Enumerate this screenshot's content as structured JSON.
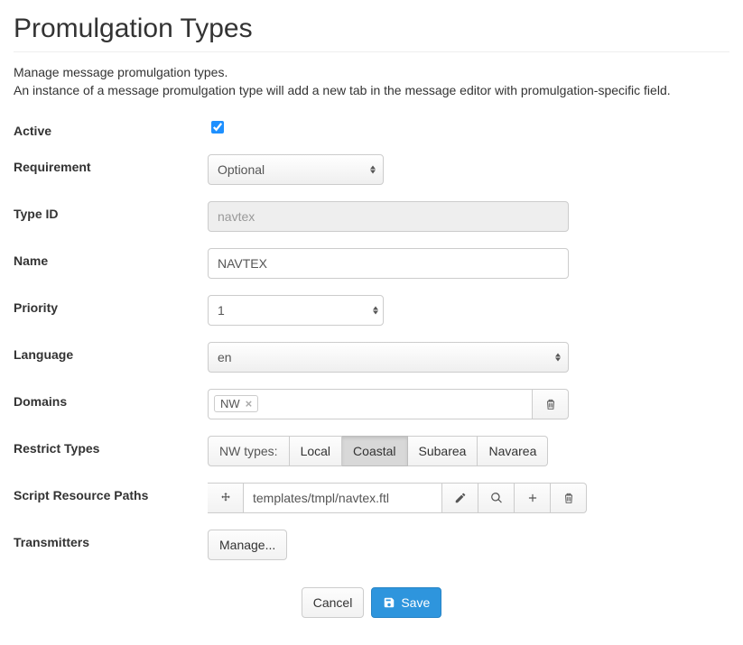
{
  "header": {
    "title": "Promulgation Types"
  },
  "description": {
    "line1": "Manage message promulgation types.",
    "line2": "An instance of a message promulgation type will add a new tab in the message editor with promulgation-specific field."
  },
  "form": {
    "active": {
      "label": "Active",
      "checked": true
    },
    "requirement": {
      "label": "Requirement",
      "value": "Optional"
    },
    "type_id": {
      "label": "Type ID",
      "value": "navtex"
    },
    "name": {
      "label": "Name",
      "value": "NAVTEX"
    },
    "priority": {
      "label": "Priority",
      "value": "1"
    },
    "language": {
      "label": "Language",
      "value": "en"
    },
    "domains": {
      "label": "Domains",
      "tags": [
        "NW"
      ]
    },
    "restrict_types": {
      "label": "Restrict Types",
      "group_label": "NW types:",
      "options": [
        "Local",
        "Coastal",
        "Subarea",
        "Navarea"
      ],
      "active_index": 1
    },
    "script_paths": {
      "label": "Script Resource Paths",
      "rows": [
        "templates/tmpl/navtex.ftl"
      ]
    },
    "transmitters": {
      "label": "Transmitters",
      "button": "Manage..."
    }
  },
  "actions": {
    "cancel": "Cancel",
    "save": "Save"
  }
}
